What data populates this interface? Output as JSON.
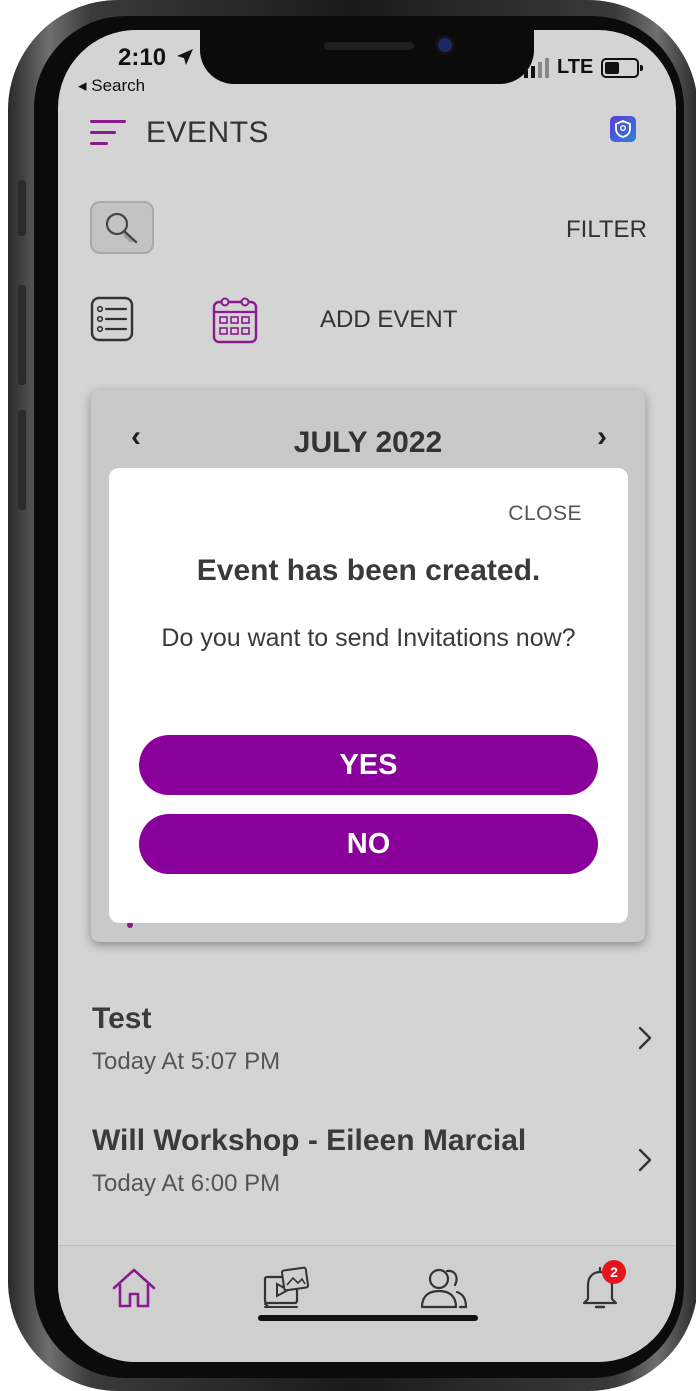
{
  "status_bar": {
    "time": "2:10",
    "back_label": "◂ Search",
    "carrier": "LTE"
  },
  "header": {
    "menu_icon": "menu-icon",
    "title": "EVENTS",
    "app_icon": "shield-icon"
  },
  "toolbar": {
    "search_icon": "search-icon",
    "filter_label": "FILTER",
    "list_view_icon": "list-icon",
    "calendar_view_icon": "calendar-icon",
    "add_event_label": "ADD EVENT"
  },
  "calendar": {
    "prev_label": "‹",
    "month_label": "JULY 2022",
    "next_label": "›"
  },
  "modal": {
    "close_label": "CLOSE",
    "title": "Event has been created.",
    "message": "Do you want to send Invitations now?",
    "yes_label": "YES",
    "no_label": "NO"
  },
  "events": [
    {
      "title": "Test",
      "time": "Today At 5:07 PM"
    },
    {
      "title": "Will Workshop - Eileen Marcial",
      "time": "Today At 6:00 PM"
    }
  ],
  "tabbar": {
    "tabs": [
      {
        "icon": "home-icon",
        "active": true
      },
      {
        "icon": "media-icon",
        "active": false
      },
      {
        "icon": "people-icon",
        "active": false
      },
      {
        "icon": "bell-icon",
        "active": false,
        "badge": "2"
      }
    ]
  },
  "colors": {
    "accent": "#8a009a",
    "badge": "#e4151f",
    "screen_bg": "#d4d4d4",
    "modal_bg": "#ffffff"
  }
}
